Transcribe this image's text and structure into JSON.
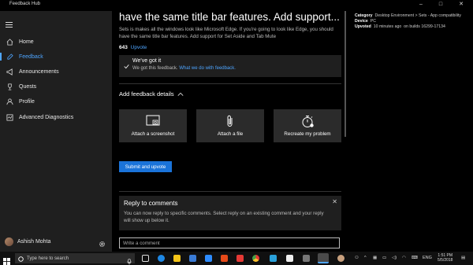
{
  "window": {
    "title": "Feedback Hub",
    "minimize": "–",
    "maximize": "□",
    "close": "✕"
  },
  "sidebar": {
    "items": [
      {
        "label": "Home",
        "icon": "home-icon"
      },
      {
        "label": "Feedback",
        "icon": "feedback-icon"
      },
      {
        "label": "Announcements",
        "icon": "megaphone-icon"
      },
      {
        "label": "Quests",
        "icon": "trophy-icon"
      },
      {
        "label": "Profile",
        "icon": "person-icon"
      },
      {
        "label": "Advanced Diagnostics",
        "icon": "diagnostics-icon"
      }
    ],
    "user": "Ashish Mohta"
  },
  "post": {
    "title": "have the same title bar features. Add support...",
    "body": "Sets is makes all the windows look like Microsoft Edge. If you're going to look like Edge, you should have the same title bar features. Add support for Set Aside and Tab Mute",
    "upvote_count": "643",
    "upvote_label": "Upvote",
    "gotit_title": "We've got it",
    "gotit_desc": "We got this feedback.",
    "gotit_link": "What we do with feedback.",
    "details_header": "Add feedback details",
    "tiles": [
      "Attach a screenshot",
      "Attach a file",
      "Recreate my problem"
    ],
    "submit_label": "Submit and upvote",
    "reply_title": "Reply to comments",
    "reply_desc": "You can now reply to specific comments. Select reply on an existing comment and your reply will show up below it.",
    "reply_close": "✕",
    "comment_placeholder": "Write a comment"
  },
  "meta": {
    "category_label": "Category",
    "category_value": "Desktop Environment > Sets - App compatibility",
    "device_label": "Device",
    "device_value": "PC",
    "upvoted_label": "Upvoted",
    "upvoted_value": "10 minutes ago",
    "build_value": "on builds 16299-17134"
  },
  "taskbar": {
    "search_placeholder": "Type here to search",
    "lang": "ENG",
    "time": "1:51 PM",
    "date": "5/5/2018"
  },
  "colors": {
    "accent": "#4ea5ff",
    "button": "#1a73d9"
  }
}
